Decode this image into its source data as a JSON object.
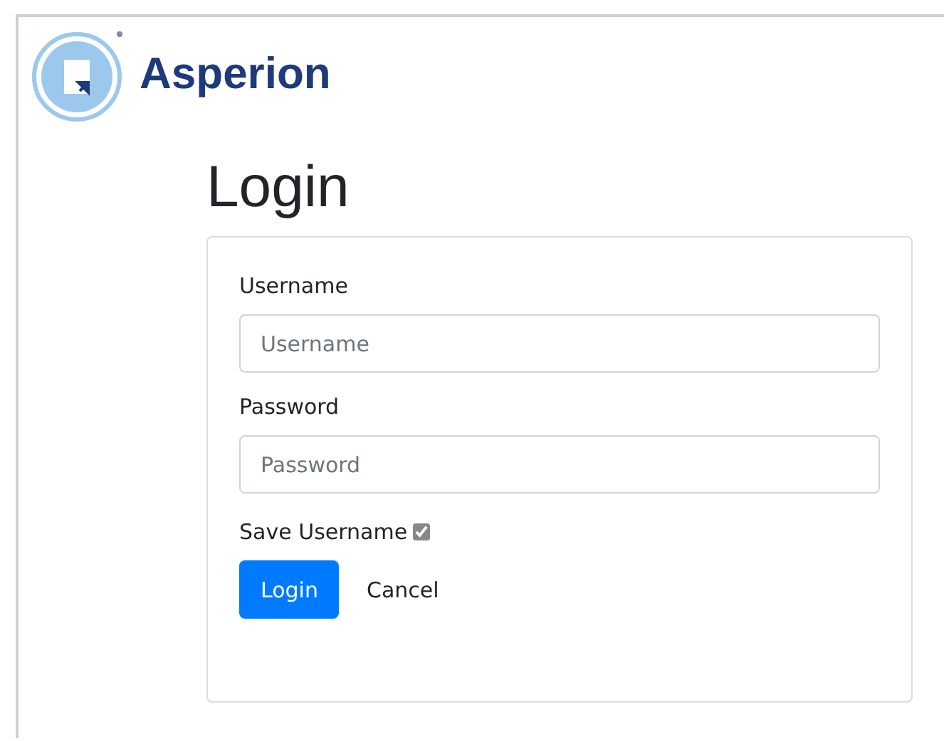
{
  "brand": {
    "name": "Asperion"
  },
  "title": "Login",
  "form": {
    "fields": [
      {
        "label": "Username",
        "placeholder": "Username"
      },
      {
        "label": "Password",
        "placeholder": "Password"
      }
    ],
    "save_username": {
      "label": "Save Username",
      "checked": true
    },
    "buttons": [
      {
        "label": "Login",
        "kind": "primary"
      },
      {
        "label": "Cancel",
        "kind": "link"
      }
    ]
  }
}
